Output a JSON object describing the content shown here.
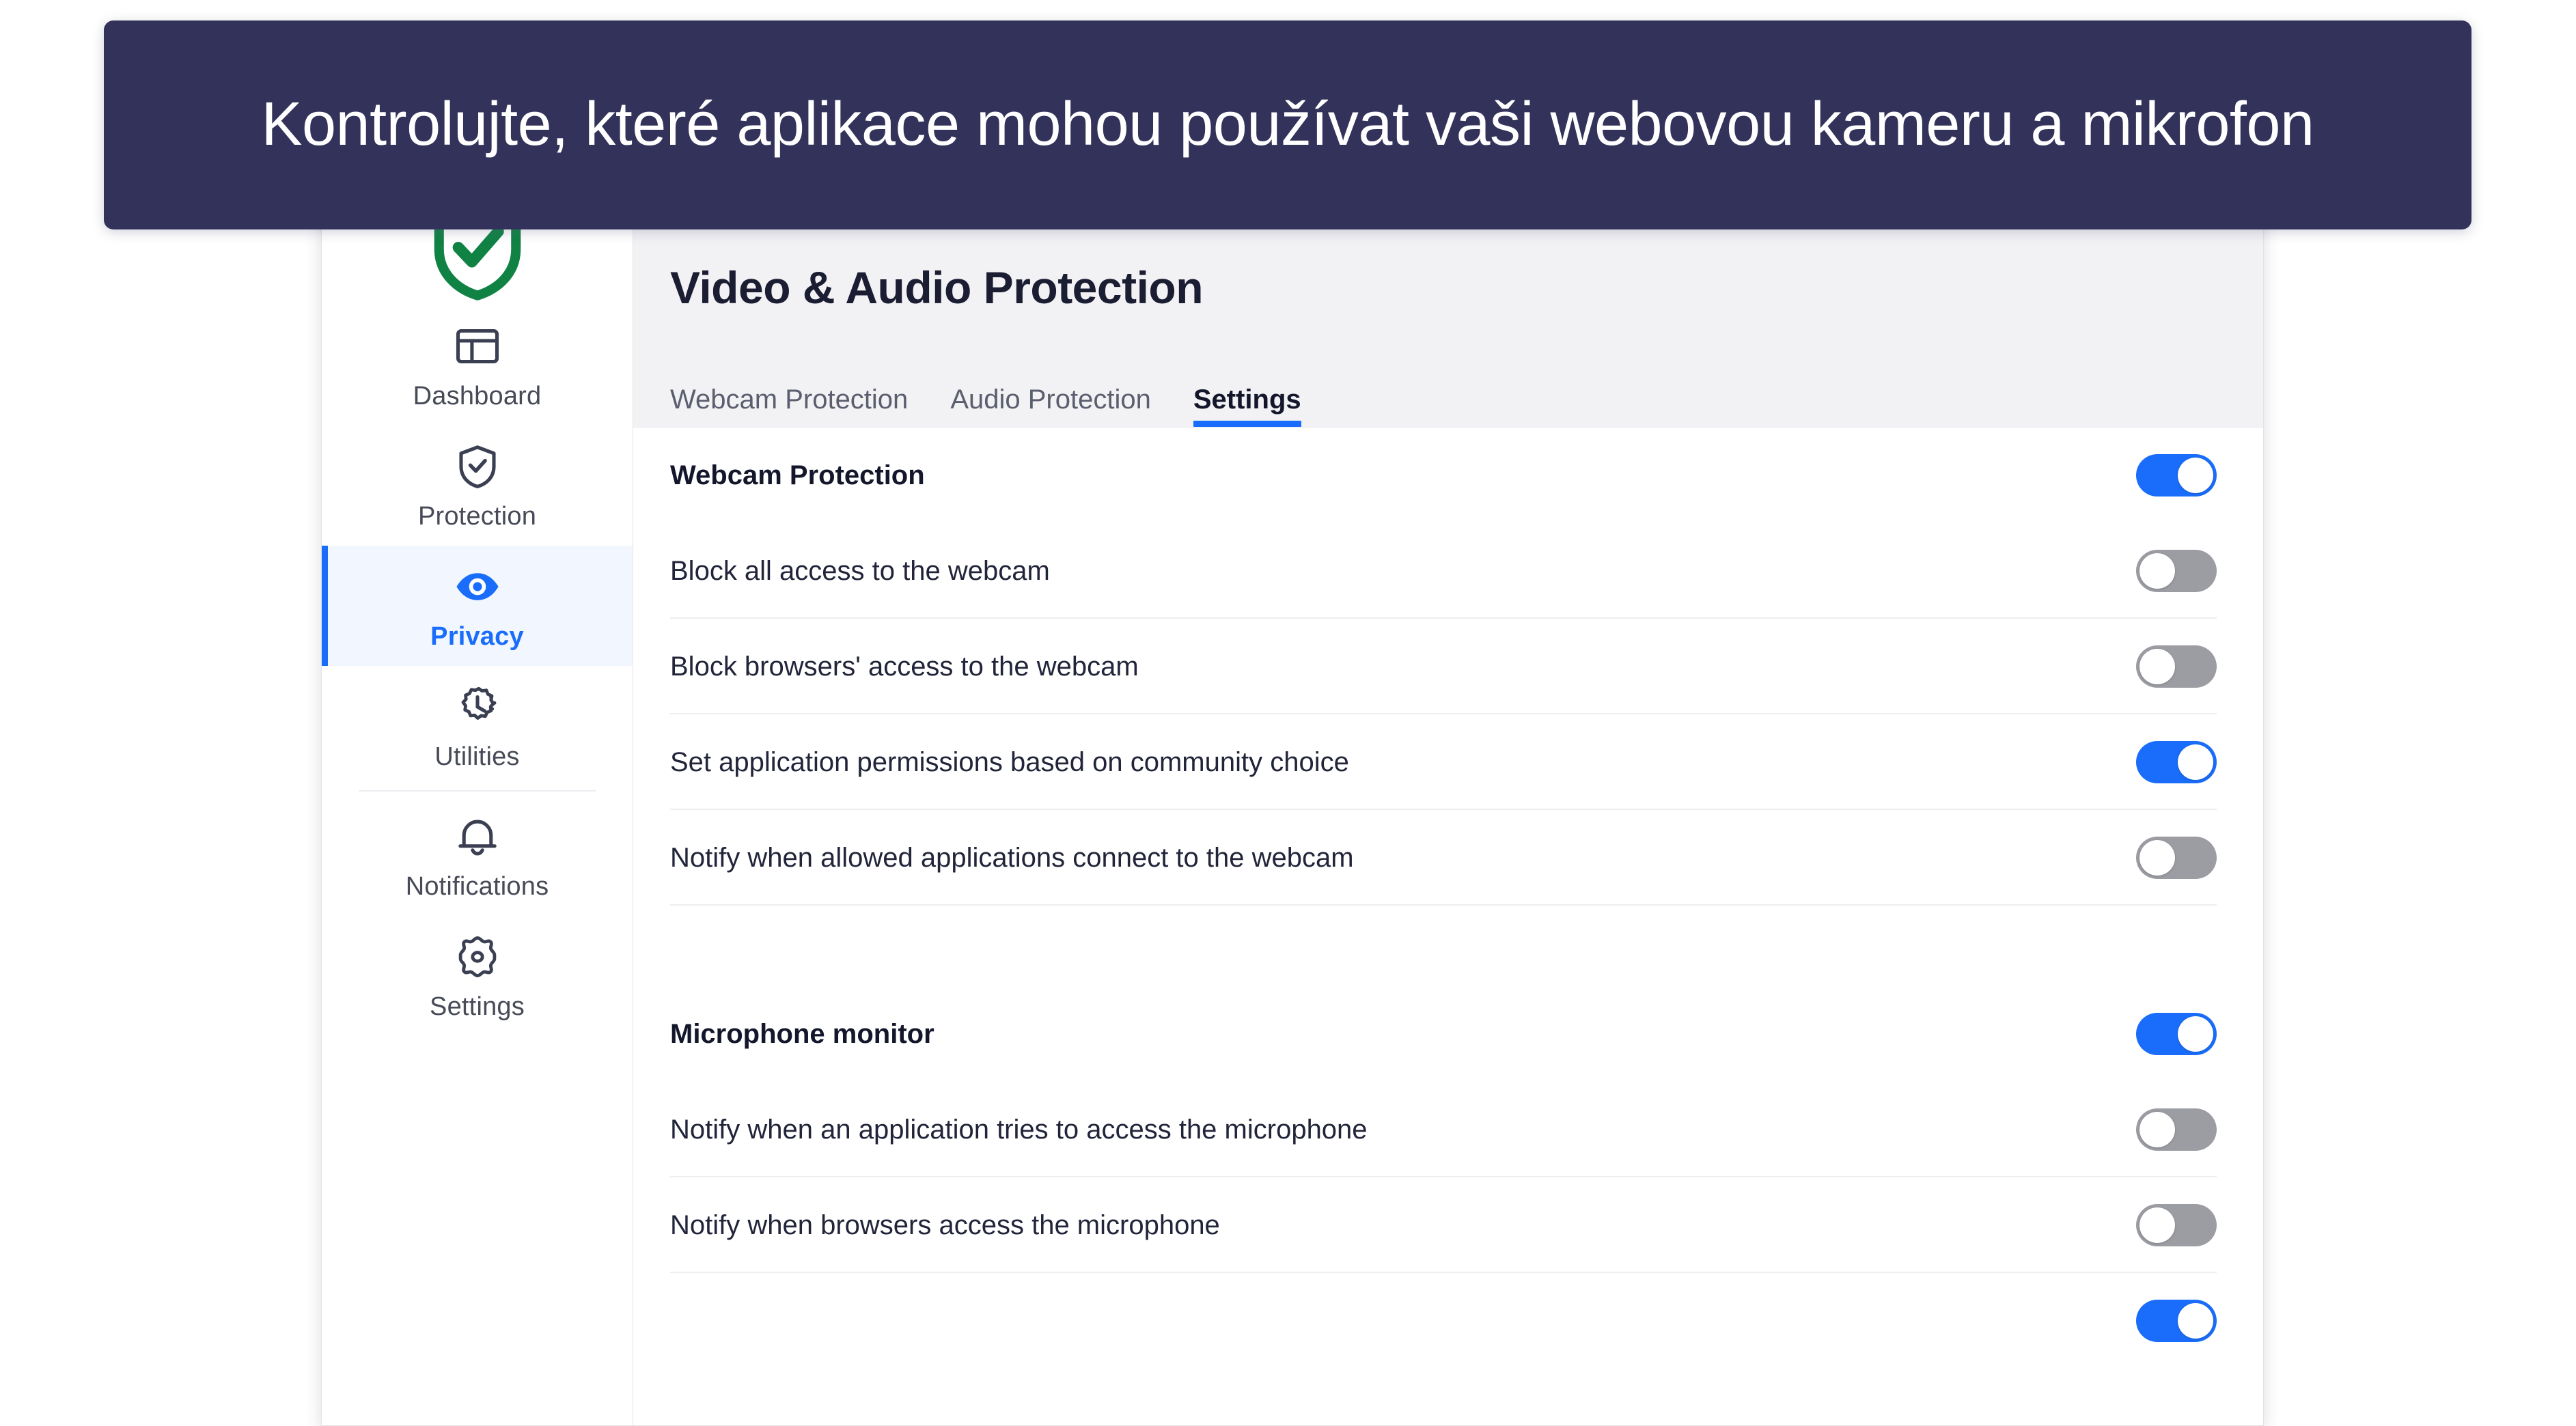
{
  "banner": {
    "text": "Kontrolujte, které aplikace mohou používat vaši webovou kameru a mikrofon",
    "background_color": "#32325a",
    "text_color": "#ffffff"
  },
  "colors": {
    "accent_blue": "#1a6dfa",
    "toggle_off_gray": "#9b9da3",
    "shield_green": "#0f8244",
    "header_bg": "#f2f2f4",
    "active_nav_bg": "#f2f7ff"
  },
  "sidebar": {
    "logo_icon": "shield-check-icon",
    "items": [
      {
        "label": "Dashboard",
        "icon": "dashboard-layout-icon",
        "active": false
      },
      {
        "label": "Protection",
        "icon": "shield-check-icon",
        "active": false
      },
      {
        "label": "Privacy",
        "icon": "eye-icon",
        "active": true
      },
      {
        "label": "Utilities",
        "icon": "gear-clock-icon",
        "active": false
      },
      {
        "label": "Notifications",
        "icon": "bell-icon",
        "active": false
      },
      {
        "label": "Settings",
        "icon": "gear-icon",
        "active": false
      }
    ]
  },
  "header": {
    "title": "Video & Audio Protection",
    "tabs": [
      {
        "label": "Webcam Protection",
        "active": false
      },
      {
        "label": "Audio Protection",
        "active": false
      },
      {
        "label": "Settings",
        "active": true
      }
    ]
  },
  "settings": {
    "rows": [
      {
        "label": "Webcam Protection",
        "group": true,
        "on": true,
        "divider": false
      },
      {
        "label": "Block all access to the webcam",
        "group": false,
        "on": false,
        "divider": true
      },
      {
        "label": "Block browsers' access to the webcam",
        "group": false,
        "on": false,
        "divider": true
      },
      {
        "label": "Set application permissions based on community choice",
        "group": false,
        "on": true,
        "divider": true
      },
      {
        "label": "Notify when allowed applications connect to the webcam",
        "group": false,
        "on": false,
        "divider": true
      },
      {
        "label": "Microphone monitor",
        "group": true,
        "on": true,
        "divider": false
      },
      {
        "label": "Notify when an application tries to access the microphone",
        "group": false,
        "on": false,
        "divider": true
      },
      {
        "label": "Notify when browsers access the microphone",
        "group": false,
        "on": false,
        "divider": true
      }
    ],
    "partial_row_on": true
  }
}
